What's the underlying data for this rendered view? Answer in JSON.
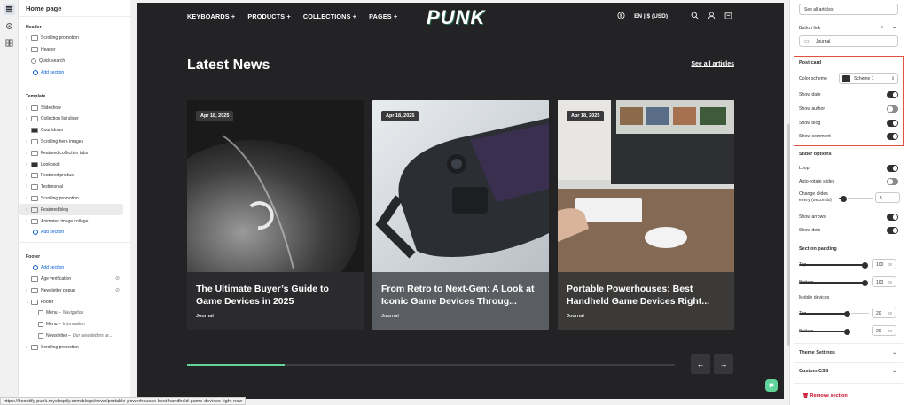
{
  "status_url": "https://boostify-punk.myshopify.com/blogs/news/portable-powerhouses-best-handheld-game-devices-right-now",
  "left": {
    "title": "Home page",
    "header_label": "Header",
    "header_items": [
      "Scrolling promotion",
      "Header",
      "Quick search"
    ],
    "add_section": "Add section",
    "template_label": "Template",
    "template_items": [
      "Slideshow",
      "Collection list slider",
      "Countdown",
      "Scrolling hero images",
      "Featured collection tabs",
      "Lookbook",
      "Featured product",
      "Testimonial",
      "Scrolling promotion",
      "Featured blog",
      "Animated image collage"
    ],
    "selected_item": "Featured blog",
    "footer_label": "Footer",
    "footer_items": [
      "Age verification",
      "Newsletter popup",
      "Footer"
    ],
    "footer_sub": [
      {
        "label": "Menu",
        "sub": "Navigation"
      },
      {
        "label": "Menu",
        "sub": "Information"
      },
      {
        "label": "Newsletter",
        "sub": "Our newsletters ar..."
      }
    ],
    "footer_last": "Scrolling promotion"
  },
  "preview": {
    "nav": [
      "KEYBOARDS +",
      "PRODUCTS +",
      "COLLECTIONS +",
      "PAGES +"
    ],
    "logo": "PUNK",
    "locale": "EN | $ (USD)",
    "section_title": "Latest News",
    "see_all": "See all articles",
    "progress": 0.2,
    "cards": [
      {
        "date": "Apr 18, 2025",
        "title": "The Ultimate Buyer’s Guide to Game Devices in 2025",
        "category": "Journal"
      },
      {
        "date": "Apr 18, 2025",
        "title": "From Retro to Next-Gen: A Look at Iconic Game Devices Throug...",
        "category": "Journal"
      },
      {
        "date": "Apr 18, 2025",
        "title": "Portable Powerhouses: Best Handheld Game Devices Right...",
        "category": "Journal"
      }
    ]
  },
  "right": {
    "button_text_value": "See all articles",
    "button_link_label": "Button link",
    "button_link_value": "Journal",
    "post_card": "Post card",
    "color_scheme_label": "Color scheme",
    "color_scheme_value": "Scheme 1",
    "show_date": "Show date",
    "show_author": "Show author",
    "show_blog": "Show blog",
    "show_comment": "Show comment",
    "slider_options": "Slider options",
    "loop": "Loop",
    "auto_rotate": "Auto-rotate slides",
    "change_slides": "Change slides every (seconds)",
    "change_slides_value": "5",
    "show_arrows": "Show arrows",
    "show_dots": "Show dots",
    "section_padding": "Section padding",
    "top": "Top",
    "bottom": "Bottom",
    "top_value": "100",
    "bottom_value": "100",
    "px": "px",
    "mobile_devices": "Mobile devices",
    "m_top": "Top",
    "m_bottom": "Bottom",
    "m_top_value": "20",
    "m_bottom_value": "20",
    "theme_settings": "Theme Settings",
    "custom_css": "Custom CSS",
    "remove_section": "Remove section"
  }
}
